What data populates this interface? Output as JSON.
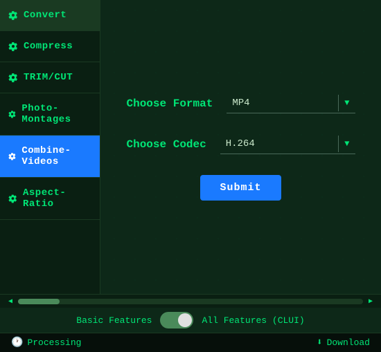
{
  "sidebar": {
    "items": [
      {
        "id": "convert",
        "label": "Convert",
        "active": false
      },
      {
        "id": "compress",
        "label": "Compress",
        "active": false
      },
      {
        "id": "trim-cut",
        "label": "TRIM/CUT",
        "active": false
      },
      {
        "id": "photo-montages",
        "label": "Photo-Montages",
        "active": false
      },
      {
        "id": "combine-videos",
        "label": "Combine-Videos",
        "active": true
      },
      {
        "id": "aspect-ratio",
        "label": "Aspect-Ratio",
        "active": false
      }
    ]
  },
  "form": {
    "format_label": "Choose Format",
    "format_value": "MP4",
    "codec_label": "Choose Codec",
    "codec_value": "H.264",
    "submit_label": "Submit"
  },
  "toggle": {
    "left_label": "Basic Features",
    "right_label": "All Features (CLUI)"
  },
  "statusbar": {
    "processing_label": "Processing",
    "download_label": "Download"
  },
  "icons": {
    "gear": "⚙",
    "clock": "🕐",
    "download": "⬇",
    "chevron_down": "▼",
    "arrow_left": "◀",
    "arrow_right": "▶"
  }
}
